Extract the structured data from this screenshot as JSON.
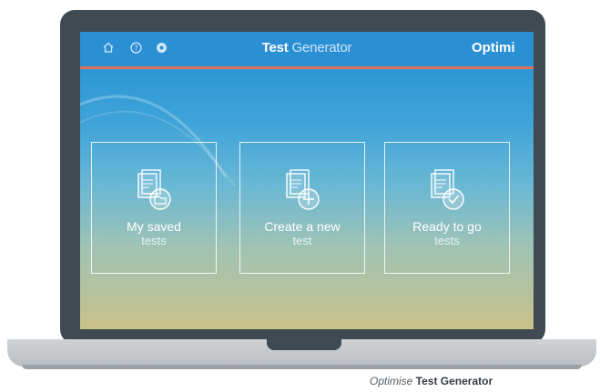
{
  "header": {
    "title_bold": "Test",
    "title_rest": " Generator",
    "brand": "Optimi",
    "icons": [
      "home-icon",
      "help-icon",
      "settings-icon"
    ]
  },
  "cards": [
    {
      "line1": "My saved",
      "line2": "tests",
      "icon": "document-folder-icon"
    },
    {
      "line1": "Create a new",
      "line2": "test",
      "icon": "document-plus-icon"
    },
    {
      "line1": "Ready to go",
      "line2": "tests",
      "icon": "document-check-icon"
    }
  ],
  "caption": {
    "italic": "Optimise",
    "bold": " Test Generator"
  },
  "colors": {
    "accent_bar": "#e0705a",
    "header_blue": "#2b8fd4",
    "bezel": "#3f4a52"
  }
}
